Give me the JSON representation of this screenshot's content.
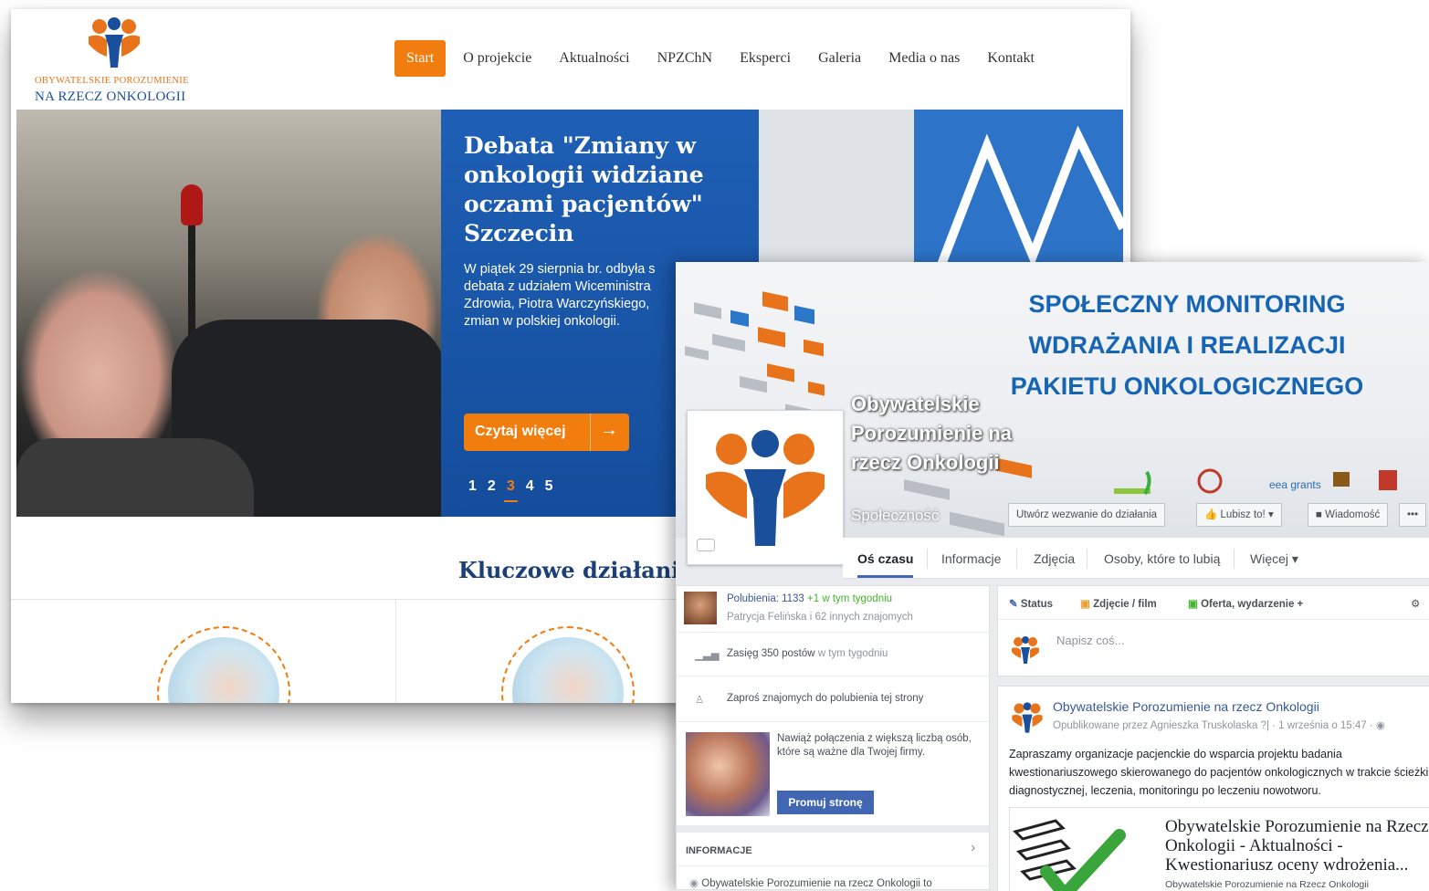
{
  "site": {
    "logo": {
      "line1": "OBYWATELSKIE POROZUMIENIE",
      "line2": "NA RZECZ ONKOLOGII"
    },
    "nav": [
      {
        "label": "Start",
        "active": true
      },
      {
        "label": "O projekcie"
      },
      {
        "label": "Aktualności"
      },
      {
        "label": "NPZChN"
      },
      {
        "label": "Eksperci"
      },
      {
        "label": "Galeria"
      },
      {
        "label": "Media o nas"
      },
      {
        "label": "Kontakt"
      }
    ],
    "hero": {
      "title": "Debata \"Zmiany w onkologii widziane oczami pacjentów\" Szczecin",
      "text": "W piątek 29 sierpnia br. odbyła s\ndebata z udziałem Wiceministra\nZdrowia, Piotra Warczyńskiego,\nzmian w polskiej onkologii.",
      "button": "Czytaj więcej",
      "pages": [
        "1",
        "2",
        "3",
        "4",
        "5"
      ],
      "active_page": 3
    },
    "section_title": "Kluczowe działania",
    "colors": {
      "orange": "#f07d0e",
      "blue": "#1a4f9c",
      "hero_blue": "#1e5fb5"
    }
  },
  "fb": {
    "cover": {
      "title": "SPOŁECZNY  MONITORING\nWDRAŻANIA I REALIZACJI\nPAKIETU ONKOLOGICZNEGO",
      "page_name": "Obywatelskie Porozumienie na rzecz Onkologii",
      "category": "Społeczność"
    },
    "actions": {
      "cta": "Utwórz wezwanie do działania",
      "like": "Lubisz to!",
      "message": "Wiadomość",
      "more": "•••"
    },
    "tabs": [
      {
        "label": "Oś czasu",
        "active": true
      },
      {
        "label": "Informacje"
      },
      {
        "label": "Zdjęcia"
      },
      {
        "label": "Osoby, które to lubią"
      },
      {
        "label": "Więcej ▾"
      }
    ],
    "left": {
      "likes": "Polubienia: 1133",
      "likes_week": "+1 w tym tygodniu",
      "likes_friends": "Patrycja Felińska i 62 innych znajomych",
      "reach": "Zasięg 350 postów",
      "reach_week": "w tym tygodniu",
      "invite": "Zaproś znajomych do polubienia tej strony",
      "promo_text": "Nawiąż połączenia z większą liczbą osób, które są ważne dla Twojej firmy.",
      "promo_button": "Promuj stronę",
      "info_header": "INFORMACJE",
      "info_text": "Obywatelskie Porozumienie na rzecz Onkologii to"
    },
    "composer": {
      "status": "Status",
      "photo": "Zdjęcie / film",
      "offer": "Oferta, wydarzenie +",
      "placeholder": "Napisz coś..."
    },
    "post": {
      "author": "Obywatelskie Porozumienie na rzecz Onkologii",
      "meta": "Opublikowane przez Agnieszka Truskolaska ?| · 1 września o 15:47 · ",
      "body": "Zapraszamy organizacje pacjenckie do wsparcia projektu badania kwestionariuszowego skierowanego do pacjentów onkologicznych w trakcie ścieżki diagnostycznej, leczenia, monitoringu po leczeniu nowotworu.",
      "link_title": "Obywatelskie Porozumienie na Rzecz Onkologii - Aktualności - Kwestionariusz oceny wdrożenia...",
      "link_sub": "Obywatelskie Porozumienie na Rzecz Onkologii"
    },
    "colors": {
      "fb_blue": "#4267b2",
      "cover_title": "#1665b5"
    }
  }
}
